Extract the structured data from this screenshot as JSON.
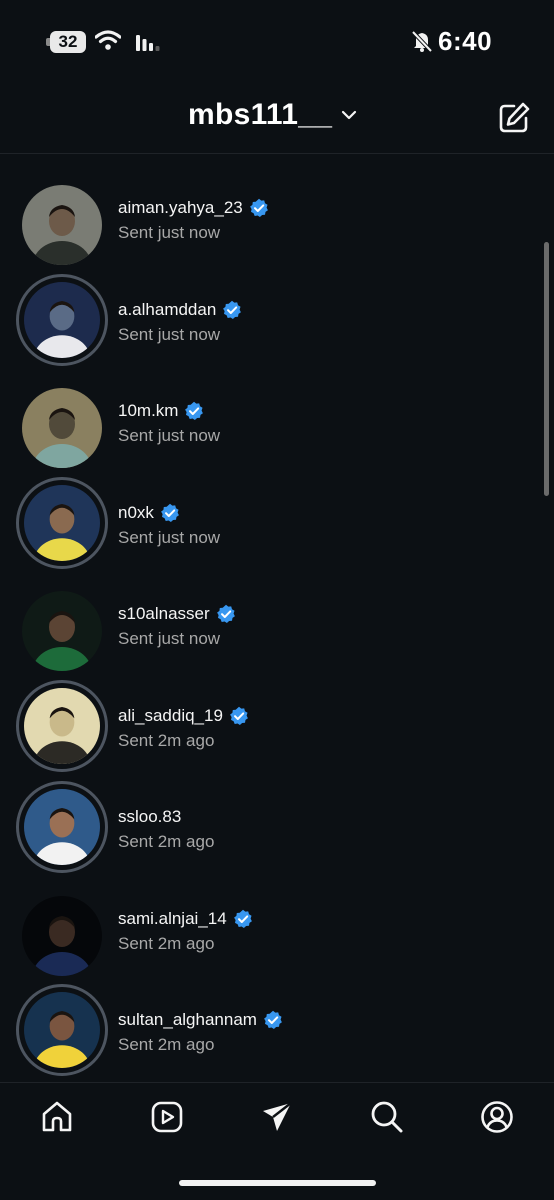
{
  "status_bar": {
    "battery": "32",
    "time": "6:40"
  },
  "header": {
    "account_name": "mbs111__"
  },
  "chats": [
    {
      "username": "aiman.yahya_23",
      "status": "Sent just now",
      "verified": true,
      "story_ring": false,
      "avatar_colors": [
        "#7a7c74",
        "#2a2f2b",
        "#6d5a49"
      ]
    },
    {
      "username": "a.alhamddan",
      "status": "Sent just now",
      "verified": true,
      "story_ring": true,
      "avatar_colors": [
        "#1d2b4d",
        "#e8e8ec",
        "#5a6b86"
      ]
    },
    {
      "username": "10m.km",
      "status": "Sent just now",
      "verified": true,
      "story_ring": false,
      "avatar_colors": [
        "#8a8060",
        "#7fa6a0",
        "#514a3a"
      ]
    },
    {
      "username": "n0xk",
      "status": "Sent just now",
      "verified": true,
      "story_ring": true,
      "avatar_colors": [
        "#1f3559",
        "#e8d84a",
        "#8a6a50"
      ]
    },
    {
      "username": "s10alnasser",
      "status": "Sent just now",
      "verified": true,
      "story_ring": false,
      "avatar_colors": [
        "#0f1a16",
        "#1d6b3a",
        "#5b4434"
      ]
    },
    {
      "username": "ali_saddiq_19",
      "status": "Sent 2m ago",
      "verified": true,
      "story_ring": true,
      "avatar_colors": [
        "#e2d9b0",
        "#2c2a25",
        "#c9b98a"
      ]
    },
    {
      "username": "ssloo.83",
      "status": "Sent 2m ago",
      "verified": false,
      "story_ring": true,
      "avatar_colors": [
        "#2f5a8a",
        "#f2f2f2",
        "#9a7055"
      ]
    },
    {
      "username": "sami.alnjai_14",
      "status": "Sent 2m ago",
      "verified": true,
      "story_ring": false,
      "avatar_colors": [
        "#05070a",
        "#1a2a55",
        "#3a2a22"
      ]
    },
    {
      "username": "sultan_alghannam",
      "status": "Sent 2m ago",
      "verified": true,
      "story_ring": true,
      "avatar_colors": [
        "#16324f",
        "#f0d23a",
        "#7a5540"
      ]
    }
  ],
  "tabs": [
    {
      "name": "tab-home",
      "icon": "home-icon"
    },
    {
      "name": "tab-reels",
      "icon": "reels-icon"
    },
    {
      "name": "tab-direct",
      "icon": "paper-plane-icon"
    },
    {
      "name": "tab-search",
      "icon": "search-icon"
    },
    {
      "name": "tab-profile",
      "icon": "profile-icon"
    }
  ]
}
